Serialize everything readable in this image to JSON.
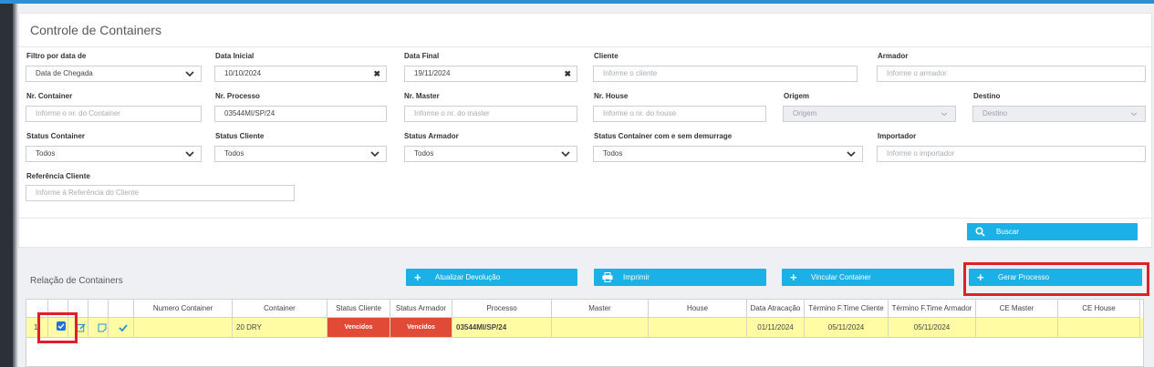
{
  "colors": {
    "accent": "#1bb1e6",
    "status_red": "#e04a36",
    "row_highlight": "#fffca3",
    "annotation_red": "#e21e26"
  },
  "panel": {
    "title": "Controle de Containers"
  },
  "filters": {
    "filtro": {
      "label": "Filtro por data de",
      "value": "Data de Chegada"
    },
    "data_inicial": {
      "label": "Data Inicial",
      "value": "10/10/2024",
      "clear": "✖"
    },
    "data_final": {
      "label": "Data Final",
      "value": "19/11/2024",
      "clear": "✖"
    },
    "cliente": {
      "label": "Cliente",
      "placeholder": "Informe o cliente"
    },
    "armador": {
      "label": "Armador",
      "placeholder": "Informe o armador"
    },
    "nr_container": {
      "label": "Nr. Container",
      "placeholder": "Informe o nr. do Container"
    },
    "nr_processo": {
      "label": "Nr. Processo",
      "value": "03544MI/SP/24"
    },
    "nr_master": {
      "label": "Nr. Master",
      "placeholder": "Informe o nr. do master"
    },
    "nr_house": {
      "label": "Nr. House",
      "placeholder": "Informe o nr. do house"
    },
    "origem": {
      "label": "Origem",
      "value": "Origem"
    },
    "destino": {
      "label": "Destino",
      "value": "Destino"
    },
    "status_container": {
      "label": "Status Container",
      "value": "Todos"
    },
    "status_cliente": {
      "label": "Status Cliente",
      "value": "Todos"
    },
    "status_armador": {
      "label": "Status Armador",
      "value": "Todos"
    },
    "status_demurrage": {
      "label": "Status Container com e sem demurrage",
      "value": "Todos"
    },
    "importador": {
      "label": "Importador",
      "placeholder": "Informe o importador"
    },
    "ref_cliente": {
      "label": "Referência Cliente",
      "placeholder": "Informe à Referência do Cliente"
    }
  },
  "buttons": {
    "buscar": "Buscar",
    "atualizar": "Atualizar Devolução",
    "imprimir": "Imprimir",
    "vincular": "Vincular Container",
    "gerar": "Gerar Processo"
  },
  "list": {
    "title": "Relação de Containers"
  },
  "table": {
    "headers": [
      "Numero Container",
      "Container",
      "Status Cliente",
      "Status Armador",
      "Processo",
      "Master",
      "House",
      "Data Atracação",
      "Término F.Time Cliente",
      "Término F.Time Armador",
      "CE Master",
      "CE House"
    ],
    "row": {
      "index": "1",
      "numero_container": "",
      "container": "20 DRY",
      "status_cliente": "Vencidos",
      "status_armador": "Vencidos",
      "processo": "03544MI/SP/24",
      "master": "",
      "house": "",
      "data_atracacao": "01/11/2024",
      "termino_cliente": "05/11/2024",
      "termino_armador": "05/11/2024",
      "ce_master": "",
      "ce_house": ""
    }
  }
}
